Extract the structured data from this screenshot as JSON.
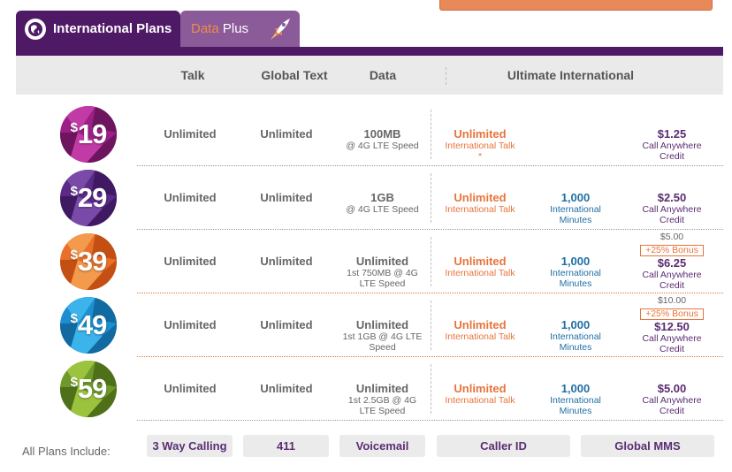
{
  "tabs": [
    {
      "label": "International Plans",
      "active": true
    },
    {
      "label_accent": "Data",
      "label_rest": " Plus",
      "active": false
    }
  ],
  "header": {
    "talk": "Talk",
    "global_text": "Global Text",
    "data": "Data",
    "ultimate": "Ultimate International"
  },
  "plans": [
    {
      "currency": "$",
      "price": "19",
      "talk": "Unlimited",
      "text": "Unlimited",
      "data_main": "100MB",
      "data_sub": "@ 4G LTE Speed",
      "intl_main": "Unlimited",
      "intl_sub": "International Talk *",
      "minutes_main": "",
      "minutes_sub": "",
      "bonus_base": "",
      "bonus_label": "",
      "credit": "$1.25",
      "credit_sub": "Call Anywhere Credit"
    },
    {
      "currency": "$",
      "price": "29",
      "talk": "Unlimited",
      "text": "Unlimited",
      "data_main": "1GB",
      "data_sub": "@ 4G LTE Speed",
      "intl_main": "Unlimited",
      "intl_sub": "International Talk",
      "minutes_main": "1,000",
      "minutes_sub": "International Minutes",
      "bonus_base": "",
      "bonus_label": "",
      "credit": "$2.50",
      "credit_sub": "Call Anywhere Credit"
    },
    {
      "currency": "$",
      "price": "39",
      "talk": "Unlimited",
      "text": "Unlimited",
      "data_main": "Unlimited",
      "data_sub": "1st 750MB @ 4G LTE Speed",
      "intl_main": "Unlimited",
      "intl_sub": "International Talk",
      "minutes_main": "1,000",
      "minutes_sub": "International Minutes",
      "bonus_base": "$5.00",
      "bonus_label": "+25% Bonus",
      "credit": "$6.25",
      "credit_sub": "Call Anywhere Credit"
    },
    {
      "currency": "$",
      "price": "49",
      "talk": "Unlimited",
      "text": "Unlimited",
      "data_main": "Unlimited",
      "data_sub": "1st 1GB @ 4G LTE Speed",
      "intl_main": "Unlimited",
      "intl_sub": "International Talk",
      "minutes_main": "1,000",
      "minutes_sub": "International Minutes",
      "bonus_base": "$10.00",
      "bonus_label": "+25% Bonus",
      "credit": "$12.50",
      "credit_sub": "Call Anywhere Credit"
    },
    {
      "currency": "$",
      "price": "59",
      "talk": "Unlimited",
      "text": "Unlimited",
      "data_main": "Unlimited",
      "data_sub": "1st 2.5GB @ 4G LTE Speed",
      "intl_main": "Unlimited",
      "intl_sub": "International Talk",
      "minutes_main": "1,000",
      "minutes_sub": "International Minutes",
      "bonus_base": "",
      "bonus_label": "",
      "credit": "$5.00",
      "credit_sub": "Call Anywhere Credit"
    }
  ],
  "badge_colors": [
    [
      "#9c1f86",
      "#c23aa5",
      "#6e1560"
    ],
    [
      "#5b2a86",
      "#7a4aa8",
      "#3f1a63"
    ],
    [
      "#e8702a",
      "#f39a4c",
      "#c44f12"
    ],
    [
      "#1d8fd0",
      "#3cb3ea",
      "#126aa0"
    ],
    [
      "#6f9a2a",
      "#9cc33e",
      "#4e7019"
    ]
  ],
  "includes": {
    "label": "All Plans Include:",
    "items": [
      "3 Way Calling",
      "411",
      "Voicemail",
      "Caller ID",
      "Global MMS"
    ]
  },
  "colors": {
    "brand_purple": "#4e1a66",
    "accent_orange": "#e8743b",
    "minutes_blue": "#1f6fa5"
  }
}
